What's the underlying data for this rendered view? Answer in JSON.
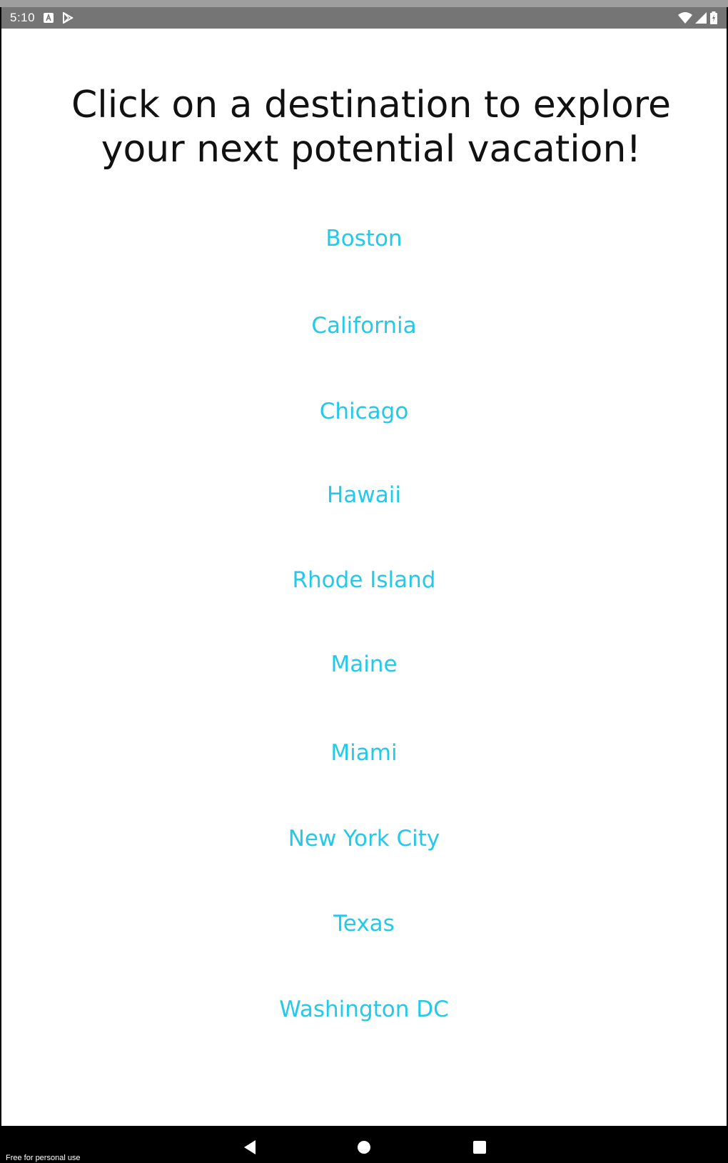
{
  "status_bar": {
    "time": "5:10",
    "left_icons": [
      "a-notification-icon",
      "play-store-icon"
    ],
    "right_icons": [
      "wifi-icon",
      "cell-signal-icon",
      "battery-icon"
    ]
  },
  "main": {
    "headline_line1": "Click on a destination to explore",
    "headline_line2": "your next potential vacation!",
    "destinations": [
      {
        "label": "Boston"
      },
      {
        "label": "California"
      },
      {
        "label": "Chicago"
      },
      {
        "label": "Hawaii"
      },
      {
        "label": "Rhode Island"
      },
      {
        "label": "Maine"
      },
      {
        "label": "Miami"
      },
      {
        "label": "New York City"
      },
      {
        "label": "Texas"
      },
      {
        "label": "Washington DC"
      }
    ]
  },
  "nav_bar": {
    "buttons": [
      "back-icon",
      "home-icon",
      "recents-icon"
    ]
  },
  "watermark": "Free for personal use",
  "colors": {
    "link": "#23c9ea",
    "status_bar": "#757575",
    "background": "#ffffff",
    "nav_bar": "#000000"
  }
}
